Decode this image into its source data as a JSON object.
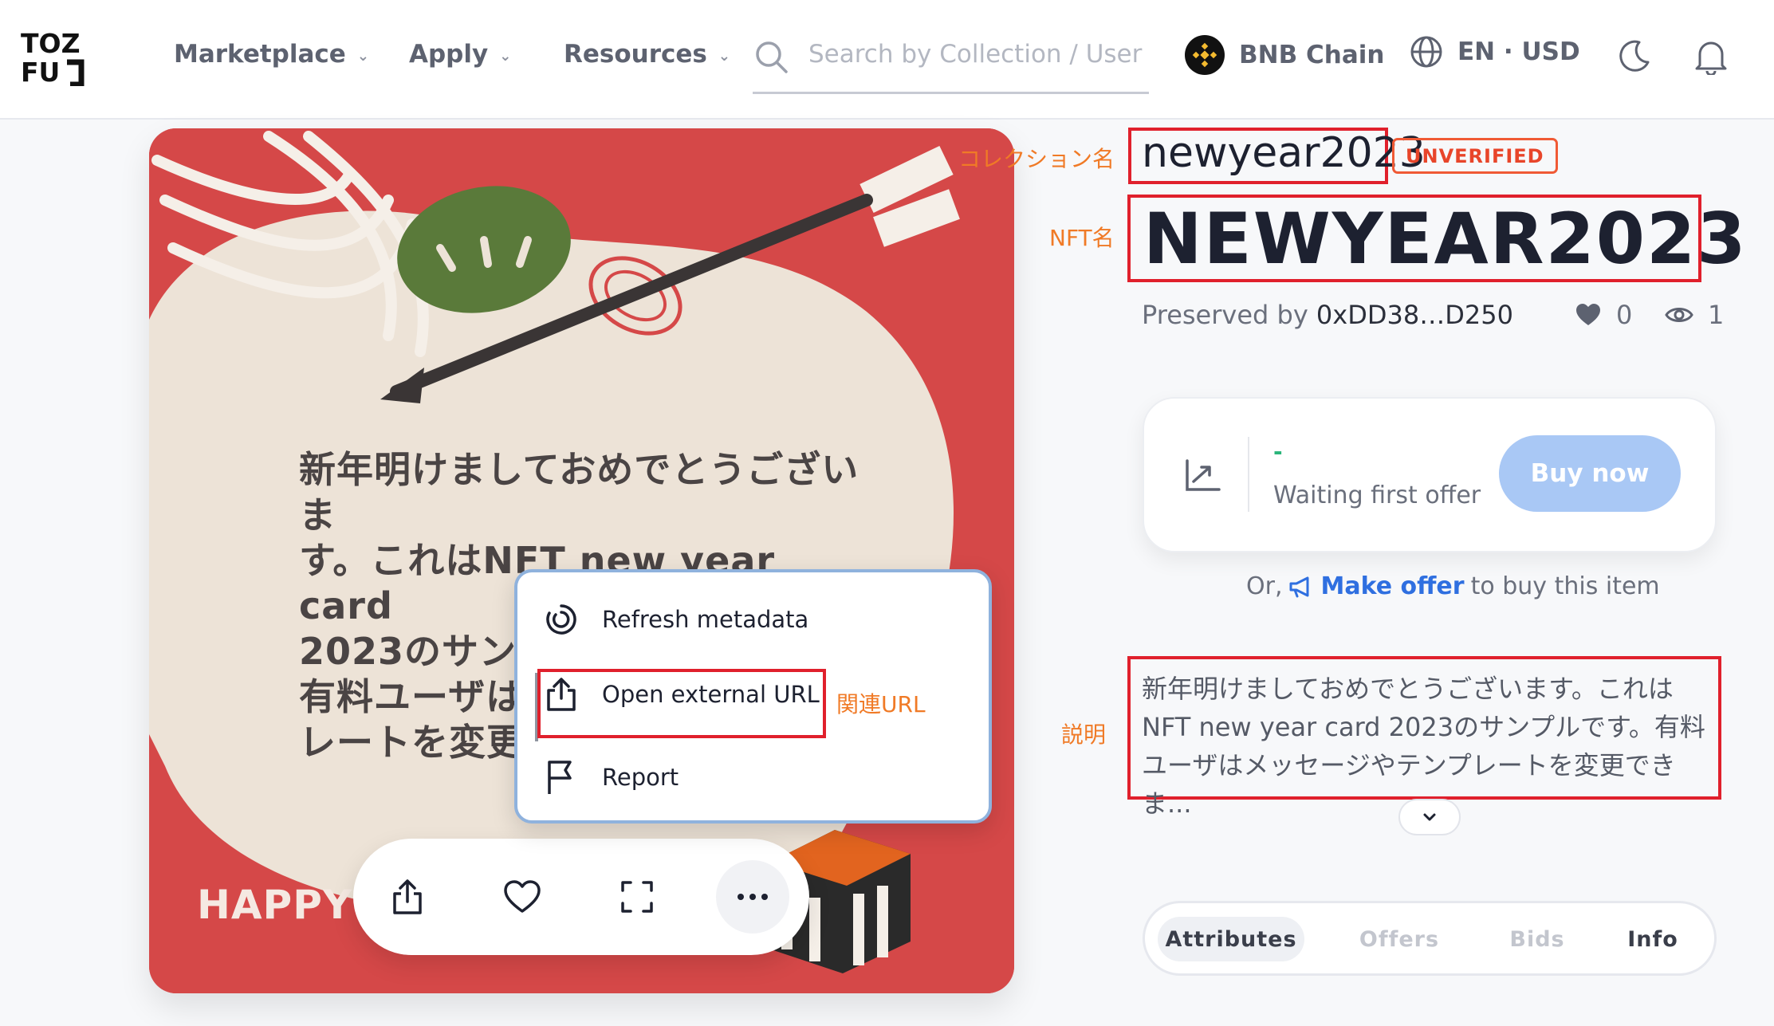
{
  "header": {
    "logo_top": "TOZ",
    "logo_bottom": "FU",
    "nav": [
      {
        "label": "Marketplace"
      },
      {
        "label": "Apply"
      },
      {
        "label": "Resources"
      }
    ],
    "search_placeholder": "Search by Collection / User /",
    "chain": "BNB Chain",
    "lang": "EN · USD"
  },
  "card": {
    "text": "新年明けましておめでとうございま\nす。これはNFT new year card\n2023のサンプルです。\n有料ユーザは\nレートを変更で",
    "happy": "HAPPY N"
  },
  "menu": {
    "refresh": "Refresh metadata",
    "open_url": "Open external URL",
    "report": "Report"
  },
  "annotations": {
    "collection": "コレクション名",
    "nft": "NFT名",
    "url": "関連URL",
    "desc": "説明"
  },
  "detail": {
    "collection_name": "newyear2023",
    "badge": "UNVERIFIED",
    "nft_name": "NEWYEAR2023",
    "preserved_label": "Preserved by",
    "preserved_addr": "0xDD38…D250",
    "likes": "0",
    "views": "1",
    "offer_dash": "-",
    "offer_wait": "Waiting first offer",
    "buy_label": "Buy now",
    "or_text": "Or,",
    "make_offer": "Make offer",
    "to_buy": "to buy this item",
    "description": "新年明けましておめでとうございます。これはNFT new year card 2023のサンプルです。有料ユーザはメッセージやテンプレートを変更できま..."
  },
  "tabs": [
    {
      "label": "Attributes"
    },
    {
      "label": "Offers"
    },
    {
      "label": "Bids"
    },
    {
      "label": "Info"
    }
  ],
  "colors": {
    "accent": "#2f6fe0",
    "card_bg": "#d54848",
    "highlight": "#e0202c",
    "annotation": "#f07a26"
  }
}
